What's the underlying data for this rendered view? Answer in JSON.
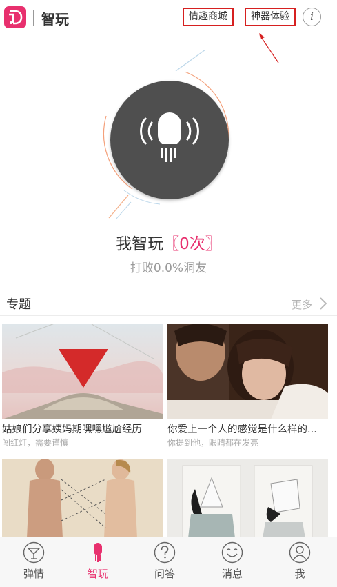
{
  "header": {
    "title": "智玩",
    "shop_link": "情趣商城",
    "trial_link": "神器体验",
    "info_glyph": "i"
  },
  "hero": {
    "prefix": "我智玩",
    "bracket_open": "〖",
    "count": "0次",
    "bracket_close": "〗",
    "beat_text": "打败0.0%洞友",
    "mic_icon": "microphone-icon"
  },
  "section": {
    "title": "专题",
    "more": "更多"
  },
  "cards": [
    {
      "title": "姑娘们分享姨妈期嘿嘿尴尬经历",
      "subtitle": "闯红灯，需要谨慎"
    },
    {
      "title": "你爱上一个人的感觉是什么样的...",
      "subtitle": "你提到他，眼睛都在发亮"
    },
    {
      "title": "",
      "subtitle": ""
    },
    {
      "title": "",
      "subtitle": ""
    }
  ],
  "tabs": [
    {
      "label": "弹情",
      "icon": "cocktail-icon",
      "active": false
    },
    {
      "label": "智玩",
      "icon": "microphone-icon",
      "active": true
    },
    {
      "label": "问答",
      "icon": "question-icon",
      "active": false
    },
    {
      "label": "消息",
      "icon": "smiley-icon",
      "active": false
    },
    {
      "label": "我",
      "icon": "user-icon",
      "active": false
    }
  ],
  "colors": {
    "accent": "#e8306e",
    "annotation": "#d62020",
    "mic_bg": "#4f4f4f"
  }
}
